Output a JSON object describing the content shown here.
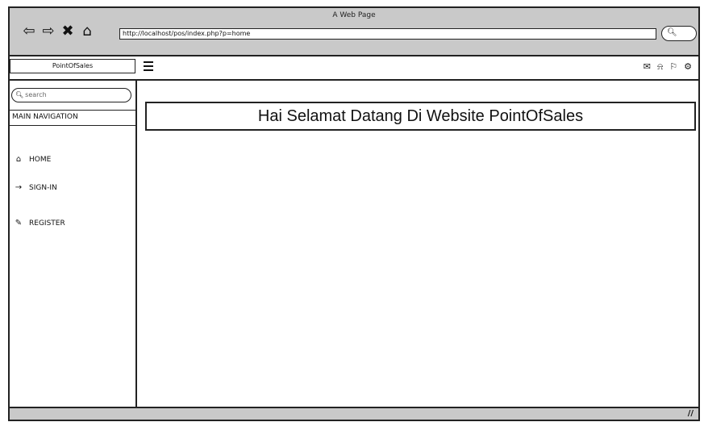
{
  "window": {
    "title": "A Web Page"
  },
  "browser": {
    "url": "http://localhost/pos/index.php?p=home",
    "buttons": {
      "back": "⇦",
      "forward": "⇨",
      "stop": "✖",
      "home": "⌂"
    },
    "search_icon": "search-icon"
  },
  "header": {
    "brand": "PointOfSales",
    "icons": [
      "envelope-icon",
      "bell-icon",
      "flag-icon",
      "gears-icon"
    ]
  },
  "sidebar": {
    "search_placeholder": "search",
    "nav_heading": "MAIN NAVIGATION",
    "items": [
      {
        "label": "HOME",
        "icon": "home-icon"
      },
      {
        "label": "SIGN-IN",
        "icon": "sign-in-icon"
      },
      {
        "label": "REGISTER",
        "icon": "edit-icon"
      }
    ]
  },
  "main": {
    "welcome": "Hai Selamat Datang Di Website PointOfSales"
  }
}
